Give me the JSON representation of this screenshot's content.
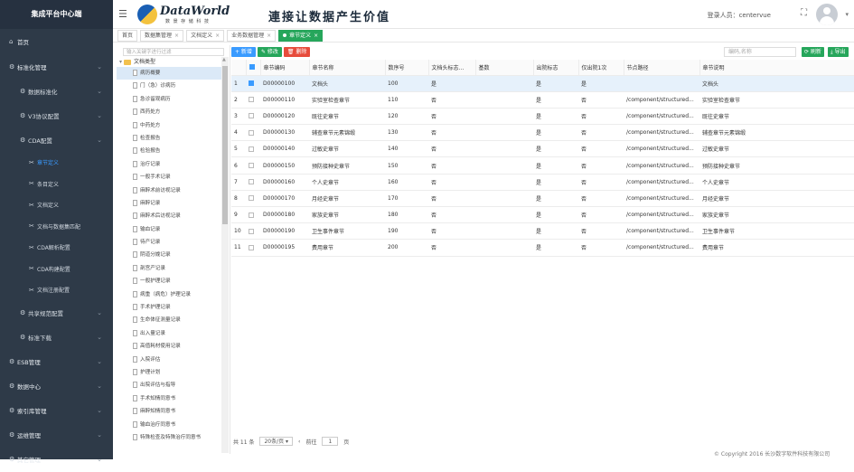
{
  "sidebar": {
    "brand": "集成平台中心端",
    "menu": [
      {
        "label": "首页",
        "level": 1,
        "icon": "home-icon",
        "chev": false,
        "name": "sidebar-item-home"
      },
      {
        "label": "标准化管理",
        "level": 1,
        "icon": "gear-icon",
        "chev": true,
        "name": "sidebar-item-standard-management"
      },
      {
        "label": "数据标准化",
        "level": 2,
        "icon": "gear-icon",
        "chev": true,
        "name": "sidebar-item-data-standardization"
      },
      {
        "label": "V3协议配置",
        "level": 2,
        "icon": "gear-icon",
        "chev": true,
        "name": "sidebar-item-v3-protocol"
      },
      {
        "label": "CDA配置",
        "level": 2,
        "icon": "gear-icon",
        "chev": true,
        "name": "sidebar-item-cda-config"
      },
      {
        "label": "章节定义",
        "level": 3,
        "icon": "wrench-icon",
        "chev": false,
        "active": true,
        "name": "sidebar-item-section-definition"
      },
      {
        "label": "条目定义",
        "level": 3,
        "icon": "wrench-icon",
        "chev": false,
        "name": "sidebar-item-entry-definition"
      },
      {
        "label": "文档定义",
        "level": 3,
        "icon": "wrench-icon",
        "chev": false,
        "name": "sidebar-item-document-definition"
      },
      {
        "label": "文档与数据集匹配",
        "level": 3,
        "icon": "wrench-icon",
        "chev": false,
        "name": "sidebar-item-document-dataset-match"
      },
      {
        "label": "CDA解析配置",
        "level": 3,
        "icon": "wrench-icon",
        "chev": false,
        "name": "sidebar-item-cda-parse-config"
      },
      {
        "label": "CDA构建配置",
        "level": 3,
        "icon": "wrench-icon",
        "chev": false,
        "name": "sidebar-item-cda-build-config"
      },
      {
        "label": "文档注册配置",
        "level": 3,
        "icon": "wrench-icon",
        "chev": false,
        "name": "sidebar-item-document-register-config"
      },
      {
        "label": "共享规范配置",
        "level": 2,
        "icon": "gear-icon",
        "chev": true,
        "name": "sidebar-item-sharing-spec"
      },
      {
        "label": "标准下载",
        "level": 2,
        "icon": "gear-icon",
        "chev": true,
        "name": "sidebar-item-standard-download"
      },
      {
        "label": "ESB管理",
        "level": 1,
        "icon": "gear-icon",
        "chev": true,
        "name": "sidebar-item-esb-management"
      },
      {
        "label": "数据中心",
        "level": 1,
        "icon": "gear-icon",
        "chev": true,
        "name": "sidebar-item-data-center"
      },
      {
        "label": "索引库管理",
        "level": 1,
        "icon": "gear-icon",
        "chev": true,
        "name": "sidebar-item-index-management"
      },
      {
        "label": "运维管理",
        "level": 1,
        "icon": "gear-icon",
        "chev": true,
        "name": "sidebar-item-ops-management"
      },
      {
        "label": "其它管理",
        "level": 1,
        "icon": "gear-icon",
        "chev": true,
        "name": "sidebar-item-other-management"
      }
    ]
  },
  "header": {
    "logo_text": "DataWorld",
    "logo_sub": "数 景 存 储 科 技",
    "slogan": "連接让数据产生价值",
    "user_label": "登录人员：centervue",
    "expand_icon": "expand-icon",
    "avatar_icon": "avatar-icon"
  },
  "tabs": [
    {
      "label": "首页",
      "close": false,
      "active": false
    },
    {
      "label": "数据集管理",
      "close": true,
      "active": false
    },
    {
      "label": "文档定义",
      "close": true,
      "active": false
    },
    {
      "label": "业务数据管理",
      "close": true,
      "active": false
    },
    {
      "label": "章节定义",
      "close": true,
      "active": true
    }
  ],
  "tree": {
    "search_placeholder": "输入关键字进行过滤",
    "root_label": "文档类型",
    "nodes": [
      "病历概要",
      "门（急）诊病历",
      "急诊留观病历",
      "西药处方",
      "中药处方",
      "检查报告",
      "检验报告",
      "治疗记录",
      "一般手术记录",
      "麻醉术前访视记录",
      "麻醉记录",
      "麻醉术后访视记录",
      "输血记录",
      "待产记录",
      "阴道分娩记录",
      "剖宫产记录",
      "一般护理记录",
      "病重（病危）护理记录",
      "手术护理记录",
      "生命体征测量记录",
      "出入量记录",
      "高值耗材使用记录",
      "入院评估",
      "护理计划",
      "出院评估与指导",
      "手术知情同意书",
      "麻醉知情同意书",
      "输血治疗同意书",
      "特殊检查及特殊治疗同意书"
    ],
    "selected_index": 0
  },
  "toolbar": {
    "add": "+ 新增",
    "edit": "✎ 修改",
    "delete": "🗑 删除",
    "search_placeholder": "编码,名称",
    "refresh": "⟳ 刷新",
    "export": "⤓ 导出"
  },
  "table": {
    "columns": [
      "章节编码",
      "章节名称",
      "数序号",
      "文档头标志...",
      "基数",
      "出院标志",
      "仅出院1次",
      "节点路径",
      "章节说明"
    ],
    "rows": [
      [
        "1",
        "D00000100",
        "文档头",
        "100",
        "是",
        "",
        "是",
        "是",
        "",
        "文档头"
      ],
      [
        "2",
        "D00000110",
        "实验室检查章节",
        "110",
        "否",
        "",
        "是",
        "否",
        "/component/structured...",
        "实验室检查章节"
      ],
      [
        "3",
        "D00000120",
        "既往史章节",
        "120",
        "否",
        "",
        "是",
        "否",
        "/component/structured...",
        "既往史章节"
      ],
      [
        "4",
        "D00000130",
        "辅查章节元素锦缎",
        "130",
        "否",
        "",
        "是",
        "否",
        "/component/structured...",
        "辅查章节元素锦缎"
      ],
      [
        "5",
        "D00000140",
        "过敏史章节",
        "140",
        "否",
        "",
        "是",
        "否",
        "/component/structured...",
        "过敏史章节"
      ],
      [
        "6",
        "D00000150",
        "预防接种史章节",
        "150",
        "否",
        "",
        "是",
        "否",
        "/component/structured...",
        "预防接种史章节"
      ],
      [
        "7",
        "D00000160",
        "个人史章节",
        "160",
        "否",
        "",
        "是",
        "否",
        "/component/structured...",
        "个人史章节"
      ],
      [
        "8",
        "D00000170",
        "月经史章节",
        "170",
        "否",
        "",
        "是",
        "否",
        "/component/structured...",
        "月经史章节"
      ],
      [
        "9",
        "D00000180",
        "家族史章节",
        "180",
        "否",
        "",
        "是",
        "否",
        "/component/structured...",
        "家族史章节"
      ],
      [
        "10",
        "D00000190",
        "卫生事件章节",
        "190",
        "否",
        "",
        "是",
        "否",
        "/component/structured...",
        "卫生事件章节"
      ],
      [
        "11",
        "D00000195",
        "费用章节",
        "200",
        "否",
        "",
        "是",
        "否",
        "/component/structured...",
        "费用章节"
      ]
    ],
    "selected_row": 0
  },
  "pager": {
    "total": "共 11 条",
    "page_size": "20条/页",
    "prev": "‹",
    "next": "›",
    "goto_label": "前往",
    "page_value": "1",
    "page_suffix": "页"
  },
  "footer": {
    "copyright": "© Copyright 2016 长沙数字软件科技有限公司"
  }
}
